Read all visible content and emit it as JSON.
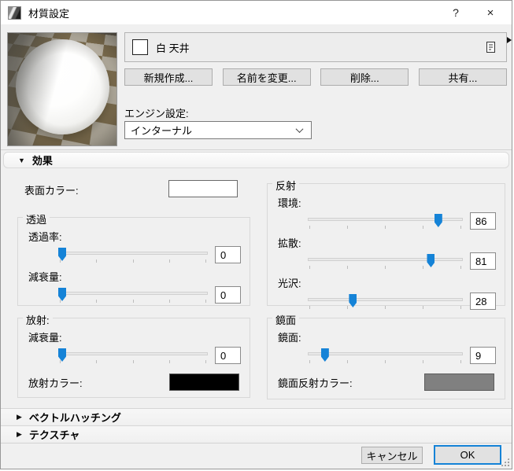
{
  "window": {
    "title": "材質設定",
    "help": "?",
    "close": "×"
  },
  "toolbar": {
    "material_name": "白 天井",
    "new_button": "新規作成...",
    "rename_button": "名前を変更...",
    "delete_button": "削除...",
    "share_button": "共有...",
    "engine_label": "エンジン設定:",
    "engine_value": "インターナル"
  },
  "sections": {
    "effects": {
      "marker": "▼",
      "label": "効果"
    },
    "vector_hatching": {
      "marker": "▶",
      "label": "ベクトルハッチング"
    },
    "texture": {
      "marker": "▶",
      "label": "テクスチャ"
    }
  },
  "effects": {
    "surface_color_label": "表面カラー:",
    "surface_color": "#ffffff",
    "transparency": {
      "title": "透過",
      "sliders": [
        {
          "label": "透過率:",
          "value": 0
        },
        {
          "label": "減衰量:",
          "value": 0
        }
      ]
    },
    "reflection": {
      "title": "反射",
      "sliders": [
        {
          "label": "環境:",
          "value": 86
        },
        {
          "label": "拡散:",
          "value": 81
        },
        {
          "label": "光沢:",
          "value": 28
        }
      ]
    },
    "emission": {
      "title": "放射:",
      "sliders": [
        {
          "label": "減衰量:",
          "value": 0
        }
      ],
      "color_label": "放射カラー:",
      "color": "#000000"
    },
    "specular": {
      "title": "鏡面",
      "sliders": [
        {
          "label": "鏡面:",
          "value": 9
        }
      ],
      "color_label": "鏡面反射カラー:",
      "color": "#808080"
    }
  },
  "footer": {
    "cancel": "キャンセル",
    "ok": "OK"
  },
  "colors": {
    "accent": "#1583d7"
  }
}
